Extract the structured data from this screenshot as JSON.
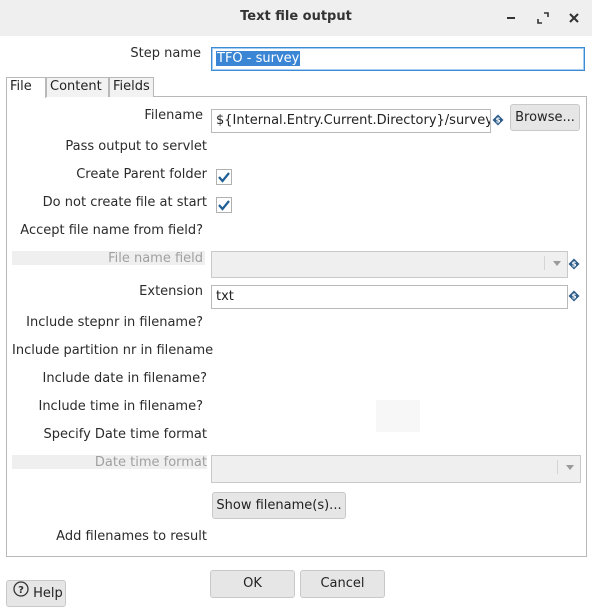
{
  "window": {
    "title": "Text file output",
    "minimize_label": "–",
    "close_label": "×"
  },
  "step_name": {
    "label": "Step name",
    "value": "TFO - survey"
  },
  "tabs": [
    {
      "label": "File",
      "active": true
    },
    {
      "label": "Content",
      "active": false
    },
    {
      "label": "Fields",
      "active": false
    }
  ],
  "file_tab": {
    "filename_label": "Filename",
    "filename_value": "${Internal.Entry.Current.Directory}/survey",
    "browse_label": "Browse...",
    "pass_output_label": "Pass output to servlet",
    "create_parent_label": "Create Parent folder",
    "create_parent_checked": true,
    "do_not_create_label": "Do not create file at start",
    "do_not_create_checked": true,
    "accept_filename_label": "Accept file name from field?",
    "file_name_field_label": "File name field",
    "file_name_field_value": "",
    "extension_label": "Extension",
    "extension_value": "txt",
    "include_stepnr_label": "Include stepnr in filename?",
    "include_partition_label": "Include partition nr in filename",
    "include_date_label": "Include date in filename?",
    "include_time_label": "Include time in filename?",
    "specify_datetime_label": "Specify Date time format",
    "datetime_format_label": "Date time format",
    "datetime_format_value": "",
    "show_filenames_label": "Show filename(s)...",
    "add_filenames_label": "Add filenames to result"
  },
  "footer": {
    "ok_label": "OK",
    "cancel_label": "Cancel",
    "help_label": "Help"
  },
  "colors": {
    "accent": "#3a86d5",
    "titlebar": "#efefef",
    "checkmark": "#1f5f95",
    "variable_icon": "#2f5e8a"
  }
}
